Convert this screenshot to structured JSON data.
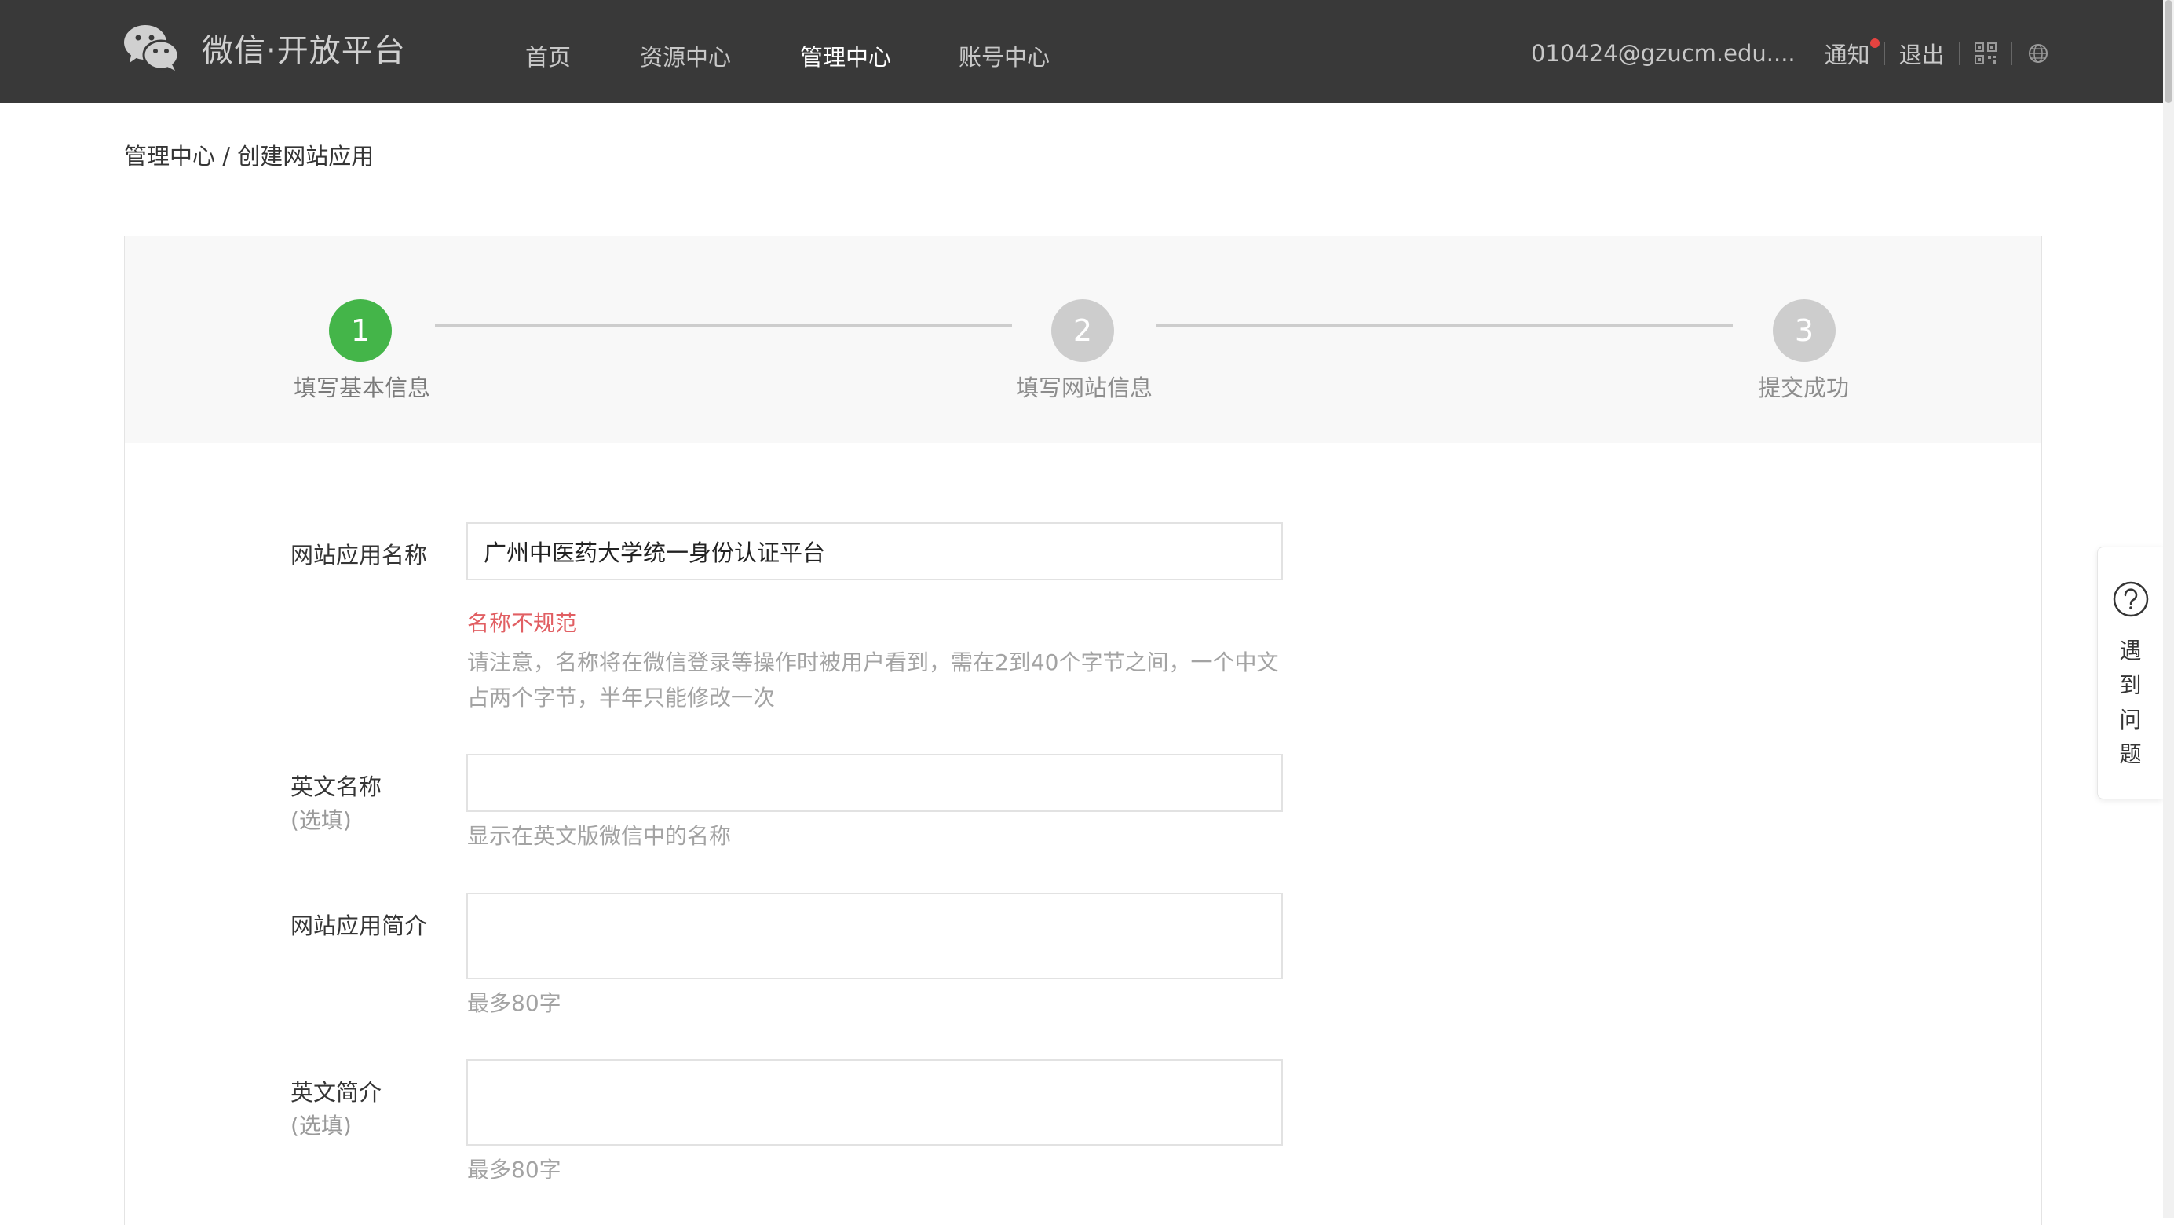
{
  "brand": {
    "name": "微信·开放平台"
  },
  "nav": {
    "items": [
      {
        "label": "首页"
      },
      {
        "label": "资源中心"
      },
      {
        "label": "管理中心"
      },
      {
        "label": "账号中心"
      }
    ],
    "active": "管理中心"
  },
  "user": {
    "account": "010424@gzucm.edu....",
    "notice": "通知",
    "logout": "退出"
  },
  "breadcrumb": "管理中心 / 创建网站应用",
  "steps": [
    {
      "num": "1",
      "label": "填写基本信息",
      "state": "done"
    },
    {
      "num": "2",
      "label": "填写网站信息",
      "state": "todo"
    },
    {
      "num": "3",
      "label": "提交成功",
      "state": "todo"
    }
  ],
  "form": {
    "app_name": {
      "label": "网站应用名称",
      "value": "广州中医药大学统一身份认证平台",
      "error": "名称不规范",
      "tip": "请注意，名称将在微信登录等操作时被用户看到，需在2到40个字节之间，一个中文占两个字节，半年只能修改一次"
    },
    "en_name": {
      "label": "英文名称",
      "optional": "(选填)",
      "value": "",
      "tip": "显示在英文版微信中的名称"
    },
    "intro": {
      "label": "网站应用简介",
      "value": "",
      "tip": "最多80字"
    },
    "en_intro": {
      "label": "英文简介",
      "optional": "(选填)",
      "value": "",
      "tip": "最多80字"
    }
  },
  "help": {
    "label": "遇到问题"
  },
  "colors": {
    "topbar": "#393939",
    "step_done": "#44b549",
    "step_todo": "#cdcdcd",
    "error": "#e15f63"
  }
}
